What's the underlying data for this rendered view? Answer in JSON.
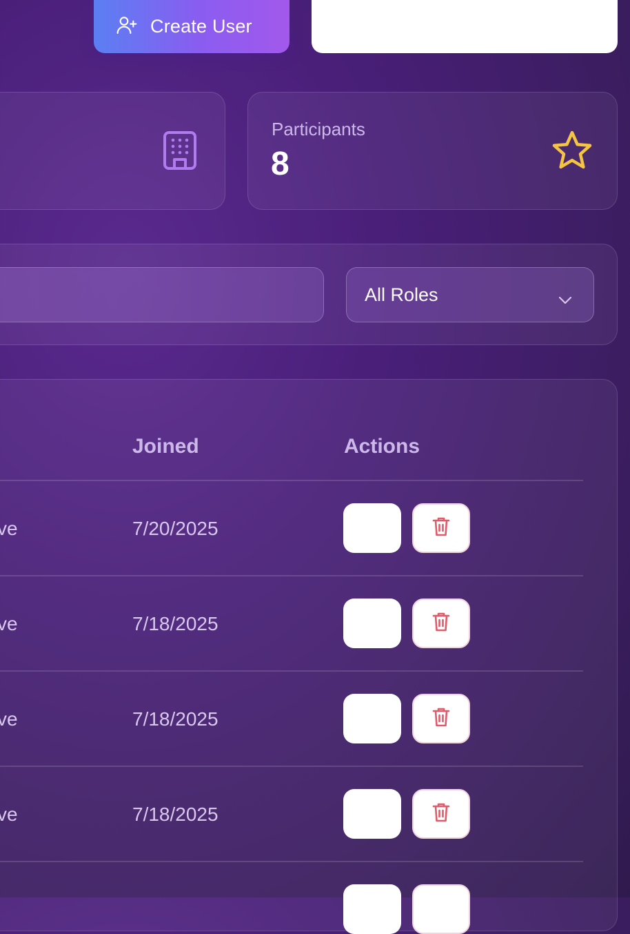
{
  "header": {
    "create_user_label": "Create User"
  },
  "stats": [
    {
      "icon": "building-icon"
    },
    {
      "label": "Participants",
      "value": "8",
      "icon": "star-icon"
    }
  ],
  "filters": {
    "search_value": "",
    "role_select_value": "All Roles"
  },
  "table": {
    "columns": {
      "joined": "Joined",
      "actions": "Actions"
    },
    "rows": [
      {
        "status_partial": "ve",
        "joined": "7/20/2025"
      },
      {
        "status_partial": "ve",
        "joined": "7/18/2025"
      },
      {
        "status_partial": "ve",
        "joined": "7/18/2025"
      },
      {
        "status_partial": "ve",
        "joined": "7/18/2025"
      }
    ]
  },
  "colors": {
    "accent_start": "#5b7ff3",
    "accent_end": "#a259ec",
    "star": "#f5c542",
    "delete": "#e05a6a",
    "building": "#b07cf0"
  }
}
